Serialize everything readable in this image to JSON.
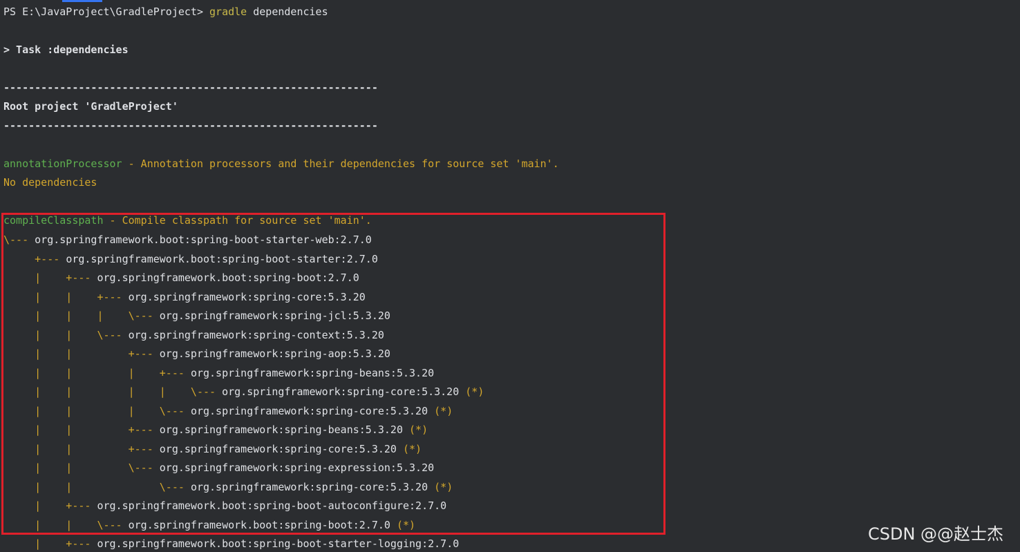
{
  "prompt": {
    "ps": "PS E:\\JavaProject\\GradleProject> ",
    "command": "gradle",
    "args": " dependencies"
  },
  "task_line": "> Task :dependencies",
  "separator": "------------------------------------------------------------",
  "root_project": "Root project 'GradleProject'",
  "annotation": {
    "config": "annotationProcessor",
    "desc": " - Annotation processors and their dependencies for source set 'main'.",
    "none": "No dependencies"
  },
  "compile": {
    "config": "compileClasspath",
    "desc": " - Compile classpath for source set 'main'."
  },
  "tree": [
    {
      "prefix": "\\--- ",
      "dep": "org.springframework.boot:spring-boot-starter-web:2.7.0",
      "star": ""
    },
    {
      "prefix": "     +--- ",
      "dep": "org.springframework.boot:spring-boot-starter:2.7.0",
      "star": ""
    },
    {
      "prefix": "     |    +--- ",
      "dep": "org.springframework.boot:spring-boot:2.7.0",
      "star": ""
    },
    {
      "prefix": "     |    |    +--- ",
      "dep": "org.springframework:spring-core:5.3.20",
      "star": ""
    },
    {
      "prefix": "     |    |    |    \\--- ",
      "dep": "org.springframework:spring-jcl:5.3.20",
      "star": ""
    },
    {
      "prefix": "     |    |    \\--- ",
      "dep": "org.springframework:spring-context:5.3.20",
      "star": ""
    },
    {
      "prefix": "     |    |         +--- ",
      "dep": "org.springframework:spring-aop:5.3.20",
      "star": ""
    },
    {
      "prefix": "     |    |         |    +--- ",
      "dep": "org.springframework:spring-beans:5.3.20",
      "star": ""
    },
    {
      "prefix": "     |    |         |    |    \\--- ",
      "dep": "org.springframework:spring-core:5.3.20",
      "star": " (*)"
    },
    {
      "prefix": "     |    |         |    \\--- ",
      "dep": "org.springframework:spring-core:5.3.20",
      "star": " (*)"
    },
    {
      "prefix": "     |    |         +--- ",
      "dep": "org.springframework:spring-beans:5.3.20",
      "star": " (*)"
    },
    {
      "prefix": "     |    |         +--- ",
      "dep": "org.springframework:spring-core:5.3.20",
      "star": " (*)"
    },
    {
      "prefix": "     |    |         \\--- ",
      "dep": "org.springframework:spring-expression:5.3.20",
      "star": ""
    },
    {
      "prefix": "     |    |              \\--- ",
      "dep": "org.springframework:spring-core:5.3.20",
      "star": " (*)"
    },
    {
      "prefix": "     |    +--- ",
      "dep": "org.springframework.boot:spring-boot-autoconfigure:2.7.0",
      "star": ""
    },
    {
      "prefix": "     |    |    \\--- ",
      "dep": "org.springframework.boot:spring-boot:2.7.0",
      "star": " (*)"
    },
    {
      "prefix": "     |    +--- ",
      "dep": "org.springframework.boot:spring-boot-starter-logging:2.7.0",
      "star": ""
    }
  ],
  "watermark": "CSDN @@赵士杰",
  "colors": {
    "background": "#2b2d30",
    "text": "#dfe1e5",
    "green": "#5fb04f",
    "yellow": "#d4a72c",
    "highlight_border": "#e0202a"
  }
}
